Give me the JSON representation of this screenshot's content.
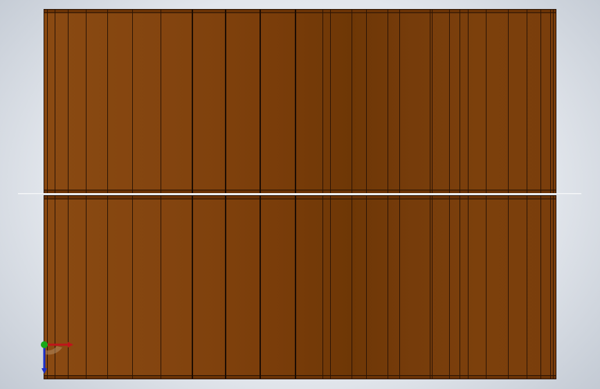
{
  "scene": {
    "background_color": "#e4e8ee",
    "wood_color": "#7c400c",
    "groove_color": "#2b1405"
  },
  "triad": {
    "x_axis_color": "#c0141a",
    "y_axis_color": "#18a818",
    "z_axis_color": "#1a2ec8",
    "icon": "view-orientation-triad-icon"
  }
}
